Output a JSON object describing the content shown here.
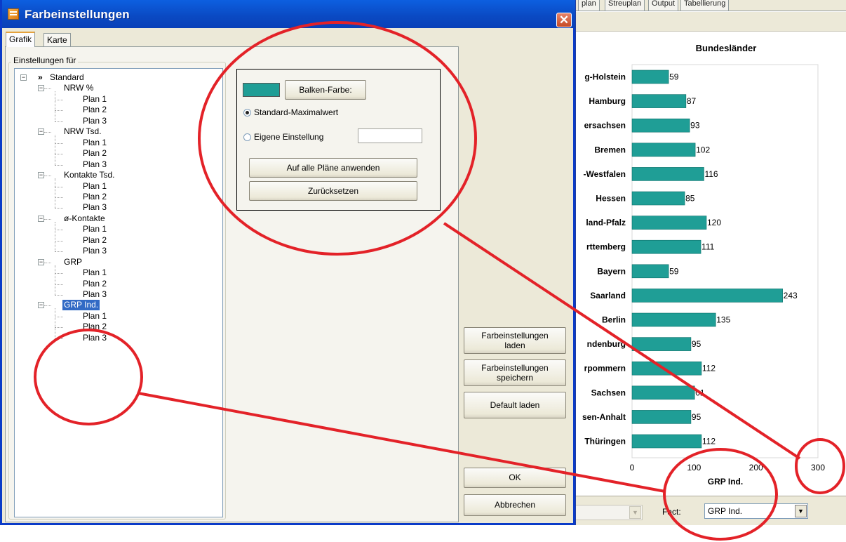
{
  "bg_window": {
    "tabs": [
      "plan",
      "Streuplan",
      "Output",
      "Tabellierung"
    ],
    "fact_label": "Fact:",
    "fact_value": "GRP Ind."
  },
  "chart_data": {
    "type": "bar",
    "orientation": "horizontal",
    "title": "Bundesländer",
    "xlabel": "GRP Ind.",
    "categories": [
      "g-Holstein",
      "Hamburg",
      "ersachsen",
      "Bremen",
      "-Westfalen",
      "Hessen",
      "land-Pfalz",
      "rttemberg",
      "Bayern",
      "Saarland",
      "Berlin",
      "ndenburg",
      "rpommern",
      "Sachsen",
      "sen-Anhalt",
      "Thüringen"
    ],
    "values": [
      59,
      87,
      93,
      102,
      116,
      85,
      120,
      111,
      59,
      243,
      135,
      95,
      112,
      101,
      95,
      112
    ],
    "data_labels": [
      "59",
      "87",
      "93",
      "102",
      "116",
      "85",
      "120",
      "111",
      "59",
      "243",
      "135",
      "95",
      "112",
      "01",
      "95",
      "112"
    ],
    "xticks": [
      "0",
      "100",
      "200",
      "300"
    ],
    "xlim": [
      0,
      300
    ],
    "grid": false,
    "bar_color": "#1f9e96"
  },
  "dialog": {
    "title": "Farbeinstellungen",
    "tabs": [
      "Grafik",
      "Karte"
    ],
    "group_title": "Einstellungen für",
    "tree": {
      "root": "Standard",
      "root_marker": "»",
      "groups": [
        {
          "label": "NRW %",
          "children": [
            "Plan 1",
            "Plan 2",
            "Plan 3"
          ]
        },
        {
          "label": "NRW Tsd.",
          "children": [
            "Plan 1",
            "Plan 2",
            "Plan 3"
          ]
        },
        {
          "label": "Kontakte Tsd.",
          "children": [
            "Plan 1",
            "Plan 2",
            "Plan 3"
          ]
        },
        {
          "label": "ø-Kontakte",
          "children": [
            "Plan 1",
            "Plan 2",
            "Plan 3"
          ]
        },
        {
          "label": "GRP",
          "children": [
            "Plan 1",
            "Plan 2",
            "Plan 3"
          ]
        },
        {
          "label": "GRP Ind.",
          "selected": true,
          "children": [
            "Plan 1",
            "Plan 2",
            "Plan 3"
          ]
        }
      ]
    },
    "color": {
      "swatch_color": "#1f9e96",
      "bar_color_button": "Balken-Farbe:",
      "radio_standard": "Standard-Maximalwert",
      "radio_custom": "Eigene Einstellung",
      "custom_value": "",
      "selected_radio": "standard",
      "apply_all_button": "Auf alle Pläne anwenden",
      "reset_button": "Zurücksetzen"
    },
    "buttons": {
      "load_line1": "Farbeinstellungen",
      "load_line2": "laden",
      "save_line1": "Farbeinstellungen",
      "save_line2": "speichern",
      "default": "Default laden",
      "ok": "OK",
      "cancel": "Abbrechen"
    },
    "close_glyph": "✕"
  },
  "annotation_color": "#e32228"
}
